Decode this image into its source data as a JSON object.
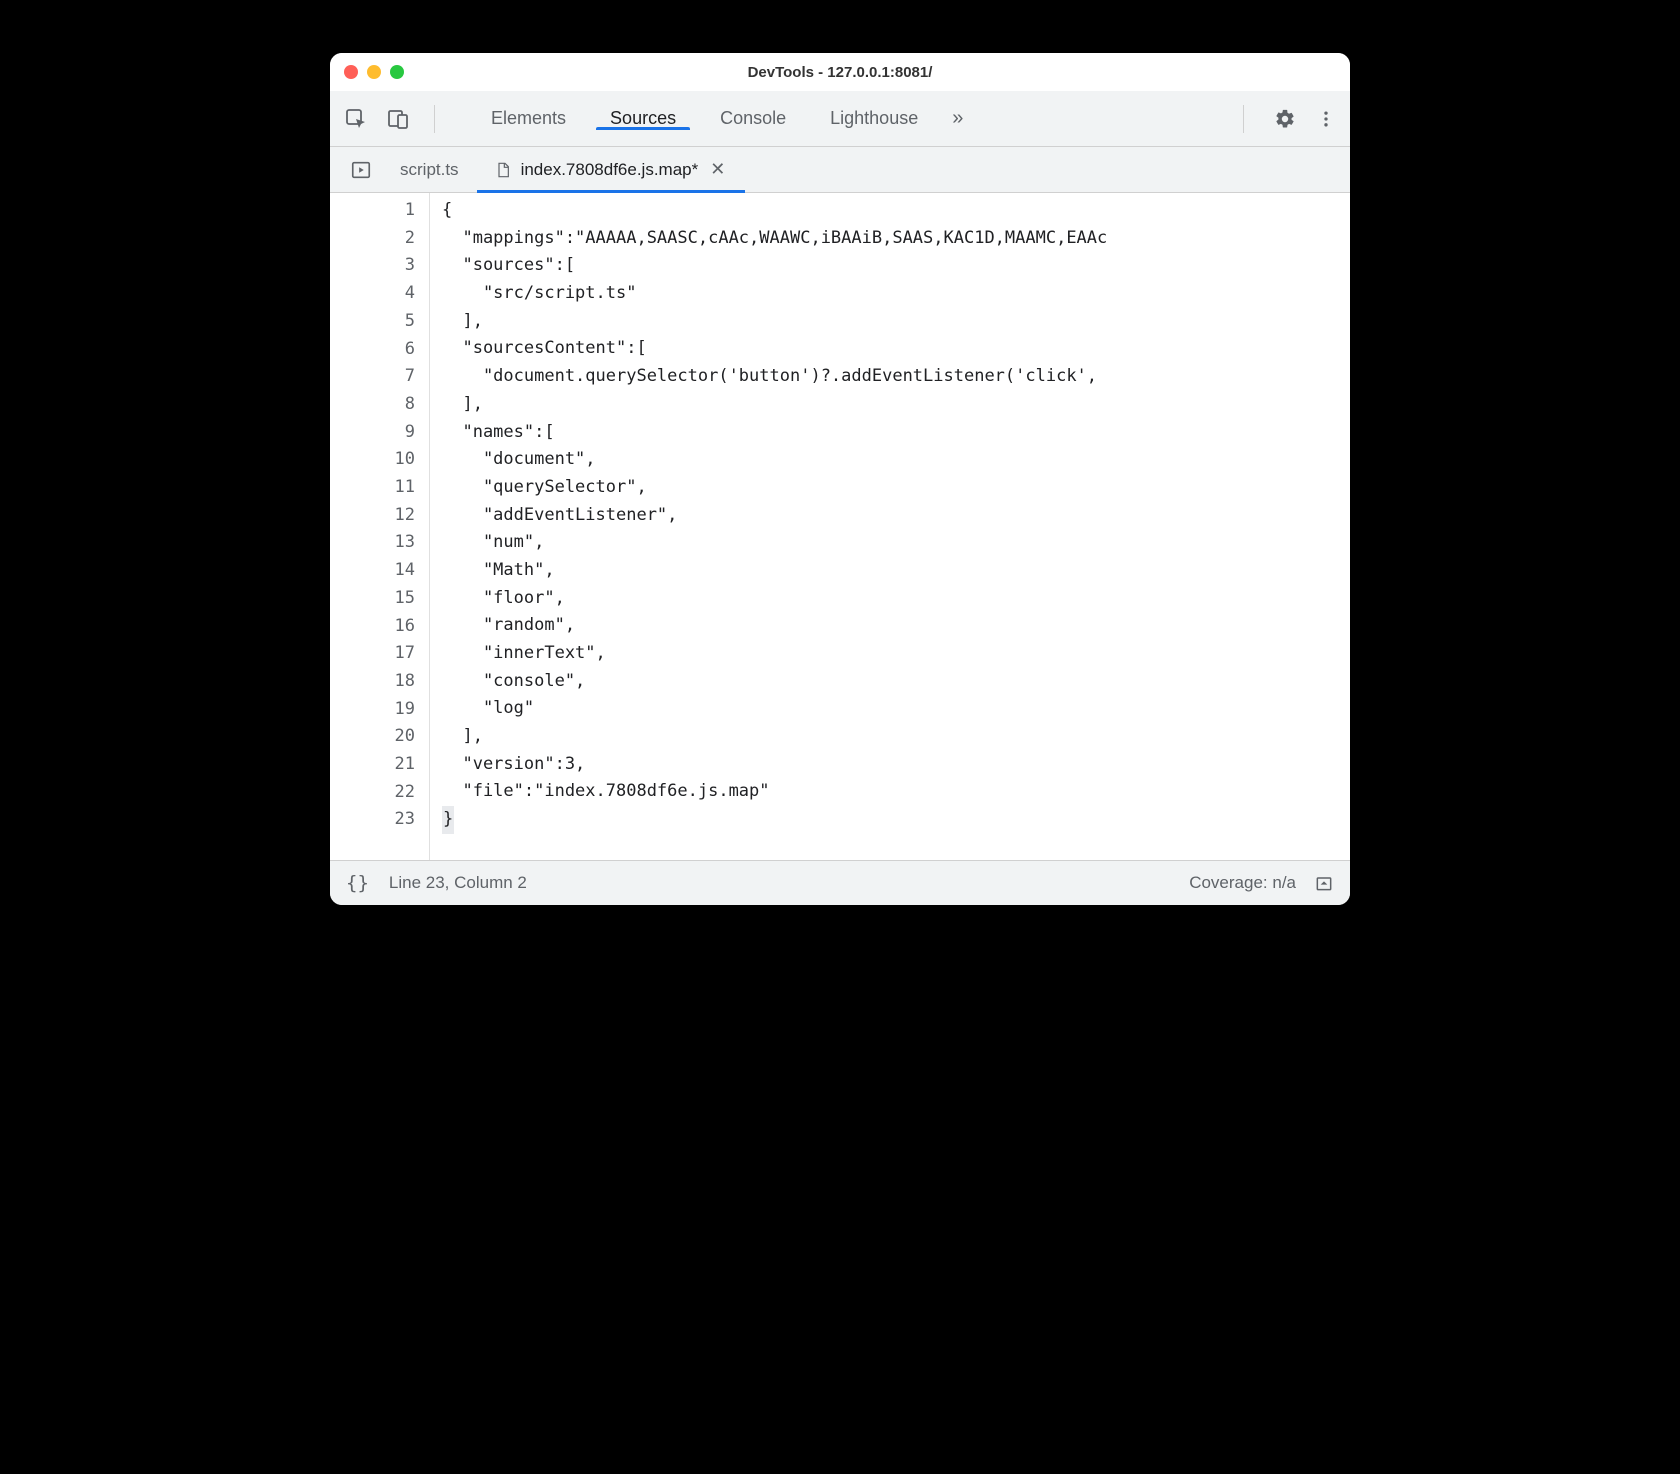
{
  "window": {
    "title": "DevTools - 127.0.0.1:8081/"
  },
  "panels": {
    "tabs": [
      "Elements",
      "Sources",
      "Console",
      "Lighthouse"
    ],
    "active": "Sources",
    "overflow_glyph": "»"
  },
  "file_tabs": {
    "items": [
      {
        "label": "script.ts",
        "icon": "none",
        "active": false,
        "closeable": false
      },
      {
        "label": "index.7808df6e.js.map*",
        "icon": "file",
        "active": true,
        "closeable": true
      }
    ]
  },
  "editor": {
    "lines": [
      "{",
      "  \"mappings\":\"AAAAA,SAASC,cAAc,WAAWC,iBAAiB,SAAS,KAC1D,MAAMC,EAAc",
      "  \"sources\":[",
      "    \"src/script.ts\"",
      "  ],",
      "  \"sourcesContent\":[",
      "    \"document.querySelector('button')?.addEventListener('click',",
      "  ],",
      "  \"names\":[",
      "    \"document\",",
      "    \"querySelector\",",
      "    \"addEventListener\",",
      "    \"num\",",
      "    \"Math\",",
      "    \"floor\",",
      "    \"random\",",
      "    \"innerText\",",
      "    \"console\",",
      "    \"log\"",
      "  ],",
      "  \"version\":3,",
      "  \"file\":\"index.7808df6e.js.map\"",
      "}"
    ]
  },
  "statusbar": {
    "braces": "{}",
    "position": "Line 23, Column 2",
    "coverage": "Coverage: n/a"
  }
}
